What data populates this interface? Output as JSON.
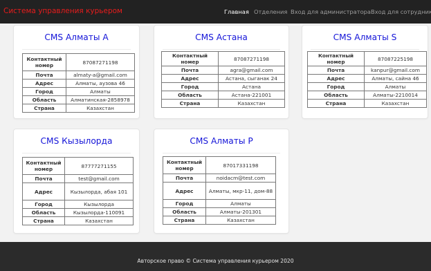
{
  "nav": {
    "brand": "Система управления курьером",
    "links": [
      "Главная",
      "Отделения",
      "Вход для администратора",
      "Вход для сотрудников"
    ]
  },
  "labels": {
    "contact": "Контактный номер",
    "email": "Почта",
    "address": "Адрес",
    "city": "Город",
    "region": "Область",
    "country": "Страна"
  },
  "offices": [
    {
      "title": "CMS Алматы A",
      "contact": "87087271198",
      "email": "almaty-a@gmail.com",
      "address": "Алматы, аузова 46",
      "city": "Алматы",
      "region": "Алматинская-2858978",
      "country": "Казахстан"
    },
    {
      "title": "CMS Астана",
      "contact": "87087271198",
      "email": "agra@gmail.com",
      "address": "Астана, сыганак 24",
      "city": "Астана",
      "region": "Астана-221001",
      "country": "Казахстан"
    },
    {
      "title": "CMS Алматы S",
      "contact": "87087225198",
      "email": "kanpur@gmail.com",
      "address": "Алматы, сайна 46",
      "city": "Алматы",
      "region": "Алматы-2210014",
      "country": "Казахстан"
    },
    {
      "title": "CMS Кызылорда",
      "contact": "87777271155",
      "email": "test@gmail.com",
      "address": "Кызылорда, абая 101",
      "city": "Кызылорда",
      "region": "Кызылорда-110091",
      "country": "Казахстан"
    },
    {
      "title": "CMS Алматы P",
      "contact": "87017331198",
      "email": "noidacm@test.com",
      "address": "Алматы, мкр-11, дом-88",
      "city": "Алматы",
      "region": "Алматы-201301",
      "country": "Казахстан"
    }
  ],
  "footer": {
    "text": "Авторское право © Система управления курьером 2020"
  }
}
